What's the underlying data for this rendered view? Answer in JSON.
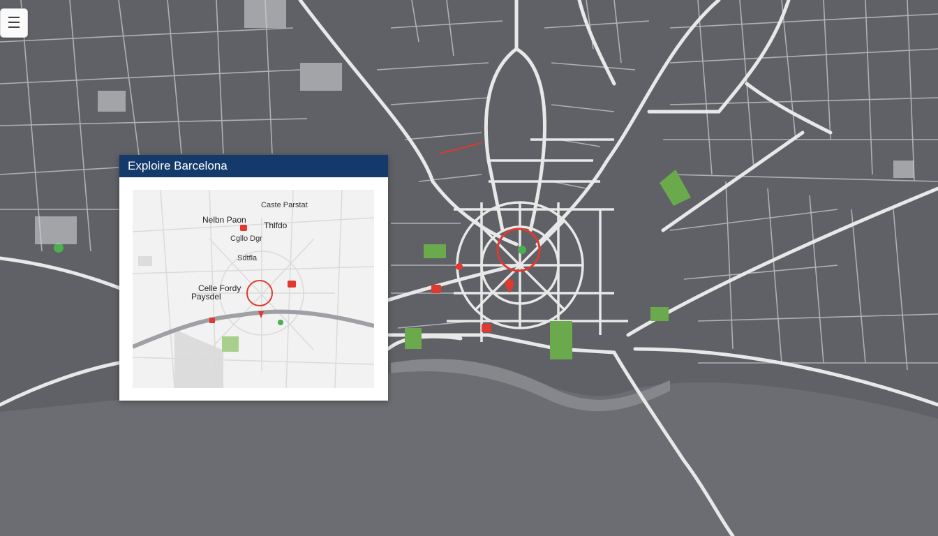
{
  "menu": {
    "icon": "menu-icon",
    "glyph": "☰"
  },
  "panel": {
    "title": "Exploire Barcelona",
    "labels": [
      "Caste Parstat",
      "Nelbn Paon",
      "Thlfdo",
      "Cgllo Dgr",
      "Sdtfla",
      "Celle Fordy",
      "Paysdel"
    ]
  },
  "colors": {
    "map_background": "#5f6166",
    "road": "#e8e8e8",
    "park": "#6aaa4c",
    "marker": "#e0392f",
    "panel_header": "#133a6a"
  },
  "markers": [
    "center-target-icon",
    "location-pin-icon",
    "landmark-marker-icon",
    "park-marker-icon"
  ]
}
